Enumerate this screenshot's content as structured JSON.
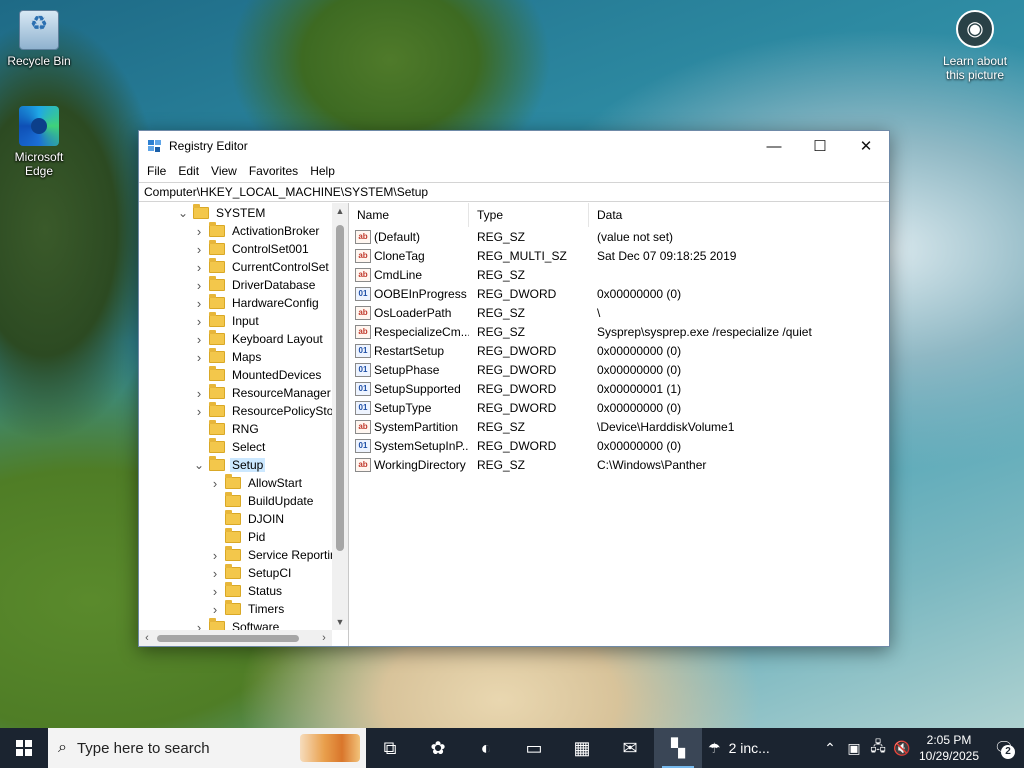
{
  "desktop": {
    "icons": [
      {
        "label": "Recycle Bin"
      },
      {
        "label": "Microsoft Edge"
      }
    ],
    "learn_label": "Learn about this picture"
  },
  "window": {
    "title": "Registry Editor",
    "controls": {
      "minimize": "—",
      "maximize": "☐",
      "close": "✕"
    },
    "menu": [
      "File",
      "Edit",
      "View",
      "Favorites",
      "Help"
    ],
    "address": "Computer\\HKEY_LOCAL_MACHINE\\SYSTEM\\Setup",
    "tree": [
      {
        "label": "SYSTEM",
        "chevron": "v",
        "level": 0
      },
      {
        "label": "ActivationBroker",
        "chevron": ">",
        "level": 1
      },
      {
        "label": "ControlSet001",
        "chevron": ">",
        "level": 1
      },
      {
        "label": "CurrentControlSet",
        "chevron": ">",
        "level": 1
      },
      {
        "label": "DriverDatabase",
        "chevron": ">",
        "level": 1
      },
      {
        "label": "HardwareConfig",
        "chevron": ">",
        "level": 1
      },
      {
        "label": "Input",
        "chevron": ">",
        "level": 1
      },
      {
        "label": "Keyboard Layout",
        "chevron": ">",
        "level": 1
      },
      {
        "label": "Maps",
        "chevron": ">",
        "level": 1
      },
      {
        "label": "MountedDevices",
        "chevron": "",
        "level": 1
      },
      {
        "label": "ResourceManager",
        "chevron": ">",
        "level": 1
      },
      {
        "label": "ResourcePolicyStore",
        "chevron": ">",
        "level": 1
      },
      {
        "label": "RNG",
        "chevron": "",
        "level": 1
      },
      {
        "label": "Select",
        "chevron": "",
        "level": 1
      },
      {
        "label": "Setup",
        "chevron": "v",
        "level": 1,
        "selected": true
      },
      {
        "label": "AllowStart",
        "chevron": ">",
        "level": 2
      },
      {
        "label": "BuildUpdate",
        "chevron": "",
        "level": 2
      },
      {
        "label": "DJOIN",
        "chevron": "",
        "level": 2
      },
      {
        "label": "Pid",
        "chevron": "",
        "level": 2
      },
      {
        "label": "Service Reporting",
        "chevron": ">",
        "level": 2
      },
      {
        "label": "SetupCI",
        "chevron": ">",
        "level": 2
      },
      {
        "label": "Status",
        "chevron": ">",
        "level": 2
      },
      {
        "label": "Timers",
        "chevron": ">",
        "level": 2
      },
      {
        "label": "Software",
        "chevron": ">",
        "level": 1
      }
    ],
    "columns": {
      "name": "Name",
      "type": "Type",
      "data": "Data"
    },
    "values": [
      {
        "name": "(Default)",
        "type": "REG_SZ",
        "data": "(value not set)",
        "icon": "string"
      },
      {
        "name": "CloneTag",
        "type": "REG_MULTI_SZ",
        "data": "Sat Dec 07 09:18:25 2019",
        "icon": "string"
      },
      {
        "name": "CmdLine",
        "type": "REG_SZ",
        "data": "",
        "icon": "string"
      },
      {
        "name": "OOBEInProgress",
        "type": "REG_DWORD",
        "data": "0x00000000 (0)",
        "icon": "binary"
      },
      {
        "name": "OsLoaderPath",
        "type": "REG_SZ",
        "data": "\\",
        "icon": "string"
      },
      {
        "name": "RespecializeCm...",
        "type": "REG_SZ",
        "data": "Sysprep\\sysprep.exe /respecialize /quiet",
        "icon": "string"
      },
      {
        "name": "RestartSetup",
        "type": "REG_DWORD",
        "data": "0x00000000 (0)",
        "icon": "binary"
      },
      {
        "name": "SetupPhase",
        "type": "REG_DWORD",
        "data": "0x00000000 (0)",
        "icon": "binary"
      },
      {
        "name": "SetupSupported",
        "type": "REG_DWORD",
        "data": "0x00000001 (1)",
        "icon": "binary"
      },
      {
        "name": "SetupType",
        "type": "REG_DWORD",
        "data": "0x00000000 (0)",
        "icon": "binary"
      },
      {
        "name": "SystemPartition",
        "type": "REG_SZ",
        "data": "\\Device\\HarddiskVolume1",
        "icon": "string"
      },
      {
        "name": "SystemSetupInP...",
        "type": "REG_DWORD",
        "data": "0x00000000 (0)",
        "icon": "binary"
      },
      {
        "name": "WorkingDirectory",
        "type": "REG_SZ",
        "data": "C:\\Windows\\Panther",
        "icon": "string"
      }
    ]
  },
  "taskbar": {
    "search_placeholder": "Type here to search",
    "weather": "2 inc...",
    "time": "2:05 PM",
    "date": "10/29/2025",
    "notifications": "2"
  }
}
